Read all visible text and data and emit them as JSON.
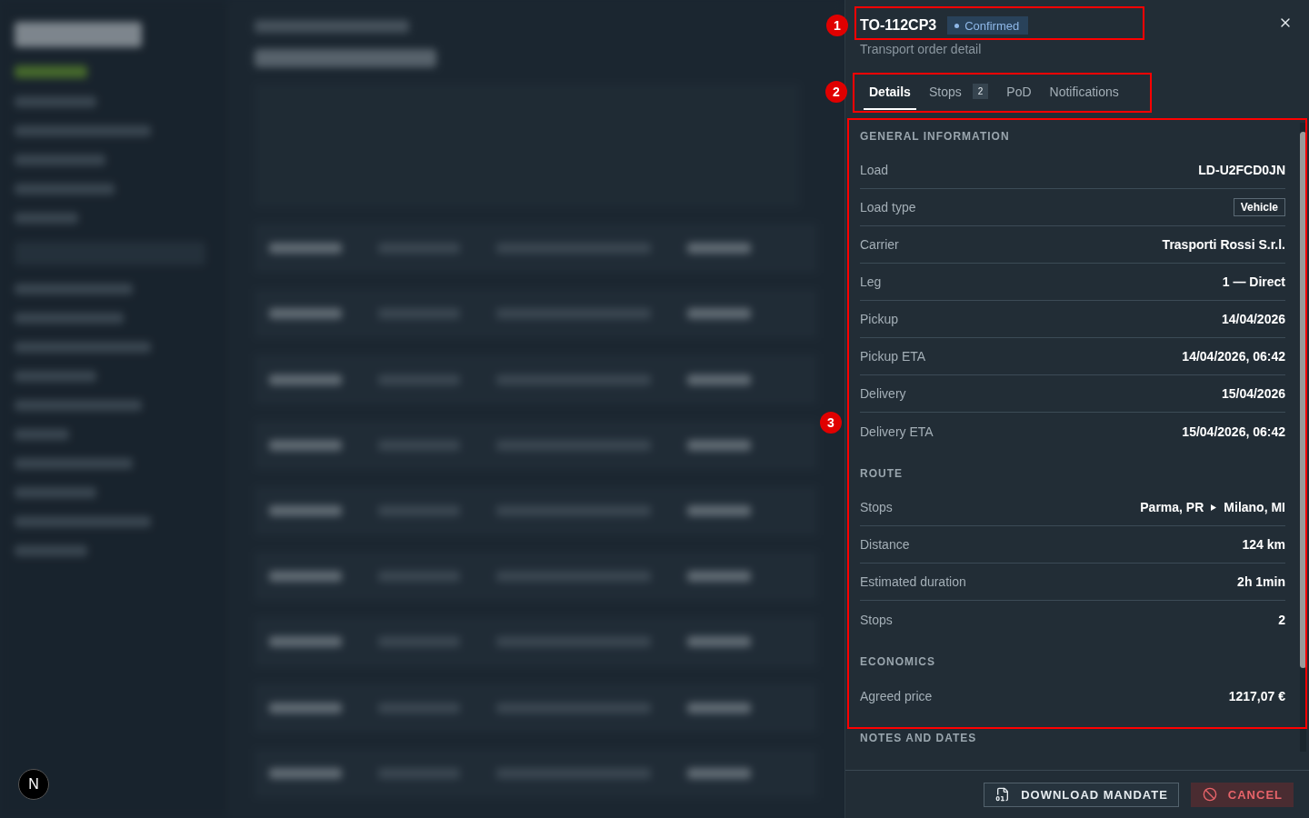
{
  "dev_badge": {
    "label": "N"
  },
  "drawer": {
    "title": "TO-112CP3",
    "status": {
      "label": "Confirmed"
    },
    "subtitle": "Transport order detail",
    "tabs": [
      {
        "label": "Details",
        "selected": true
      },
      {
        "label": "Stops",
        "badge": "2",
        "selected": false
      },
      {
        "label": "PoD",
        "selected": false
      },
      {
        "label": "Notifications",
        "selected": false
      }
    ],
    "sections": [
      {
        "heading": "GENERAL INFORMATION",
        "rows": [
          {
            "label": "Load",
            "value": "LD-U2FCD0JN",
            "kind": "text"
          },
          {
            "label": "Load type",
            "value": "Vehicle",
            "kind": "tag"
          },
          {
            "label": "Carrier",
            "value": "Trasporti Rossi S.r.l.",
            "kind": "text"
          },
          {
            "label": "Leg",
            "value": "1 — Direct",
            "kind": "text"
          },
          {
            "label": "Pickup",
            "value": "14/04/2026",
            "kind": "text"
          },
          {
            "label": "Pickup ETA",
            "value": "14/04/2026, 06:42",
            "kind": "text"
          },
          {
            "label": "Delivery",
            "value": "15/04/2026",
            "kind": "text"
          },
          {
            "label": "Delivery ETA",
            "value": "15/04/2026, 06:42",
            "kind": "text"
          }
        ]
      },
      {
        "heading": "ROUTE",
        "rows": [
          {
            "label": "Stops",
            "stops": [
              "Parma, PR",
              "Milano, MI"
            ],
            "kind": "route"
          },
          {
            "label": "Distance",
            "value": "124 km",
            "kind": "text"
          },
          {
            "label": "Estimated duration",
            "value": "2h 1min",
            "kind": "text"
          },
          {
            "label": "Stops",
            "value": "2",
            "kind": "text"
          }
        ]
      },
      {
        "heading": "ECONOMICS",
        "rows": [
          {
            "label": "Agreed price",
            "value": "1217,07 €",
            "kind": "text"
          }
        ]
      },
      {
        "heading": "NOTES AND DATES"
      }
    ],
    "footer_buttons": [
      {
        "label": "DOWNLOAD MANDATE",
        "kind": "download"
      },
      {
        "label": "CANCEL",
        "kind": "cancel"
      }
    ]
  },
  "annotations": [
    {
      "number": "1"
    },
    {
      "number": "2"
    },
    {
      "number": "3"
    }
  ]
}
